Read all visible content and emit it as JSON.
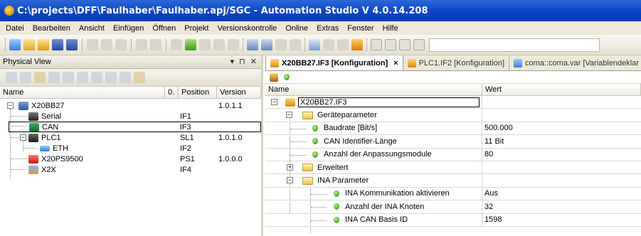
{
  "window": {
    "title": "C:\\projects\\DFF\\Faulhaber\\Faulhaber.apj/SGC - Automation Studio V 4.0.14.208"
  },
  "menu": [
    "Datei",
    "Bearbeiten",
    "Ansicht",
    "Einfügen",
    "Öffnen",
    "Projekt",
    "Versionskontrolle",
    "Online",
    "Extras",
    "Fenster",
    "Hilfe"
  ],
  "physical_view": {
    "title": "Physical View",
    "controls": "▾ ⊓ ✕",
    "columns": [
      "Name",
      "0.",
      "Position",
      "Version"
    ],
    "rows": [
      {
        "name": "X20BB27",
        "position": "",
        "version": "1.0.1.1"
      },
      {
        "name": "Serial",
        "position": "IF1",
        "version": ""
      },
      {
        "name": "CAN",
        "position": "IF3",
        "version": ""
      },
      {
        "name": "PLC1",
        "position": "SL1",
        "version": "1.0.1.0"
      },
      {
        "name": "ETH",
        "position": "IF2",
        "version": ""
      },
      {
        "name": "X20PS9500",
        "position": "PS1",
        "version": "1.0.0.0"
      },
      {
        "name": "X2X",
        "position": "IF4",
        "version": ""
      }
    ]
  },
  "editor": {
    "tabs": [
      {
        "label": "X20BB27.IF3 [Konfiguration]",
        "close": "×"
      },
      {
        "label": "PLC1.IF2 [Konfiguration]"
      },
      {
        "label": "coma::coma.var [Variablendeklar"
      }
    ],
    "columns": [
      "Name",
      "Wert"
    ],
    "rows": [
      {
        "name": "X20BB27.IF3",
        "value": ""
      },
      {
        "name": "Geräteparameter",
        "value": ""
      },
      {
        "name": "Baudrate [Bit/s]",
        "value": "500.000"
      },
      {
        "name": "CAN Identifier-Länge",
        "value": "11 Bit"
      },
      {
        "name": "Anzahl der Anpassungsmodule",
        "value": "80"
      },
      {
        "name": "Erweitert",
        "value": ""
      },
      {
        "name": "INA Parameter",
        "value": ""
      },
      {
        "name": "INA Kommunikation aktivieren",
        "value": "Aus"
      },
      {
        "name": "Anzahl der INA Knoten",
        "value": "32"
      },
      {
        "name": "INA CAN Basis ID",
        "value": "1598"
      }
    ]
  },
  "colors": {
    "titlebar": "#0a45c4",
    "menubar": "#ece9d8",
    "bullet_green": "#42a61a",
    "folder_yellow": "#e8c35a"
  }
}
